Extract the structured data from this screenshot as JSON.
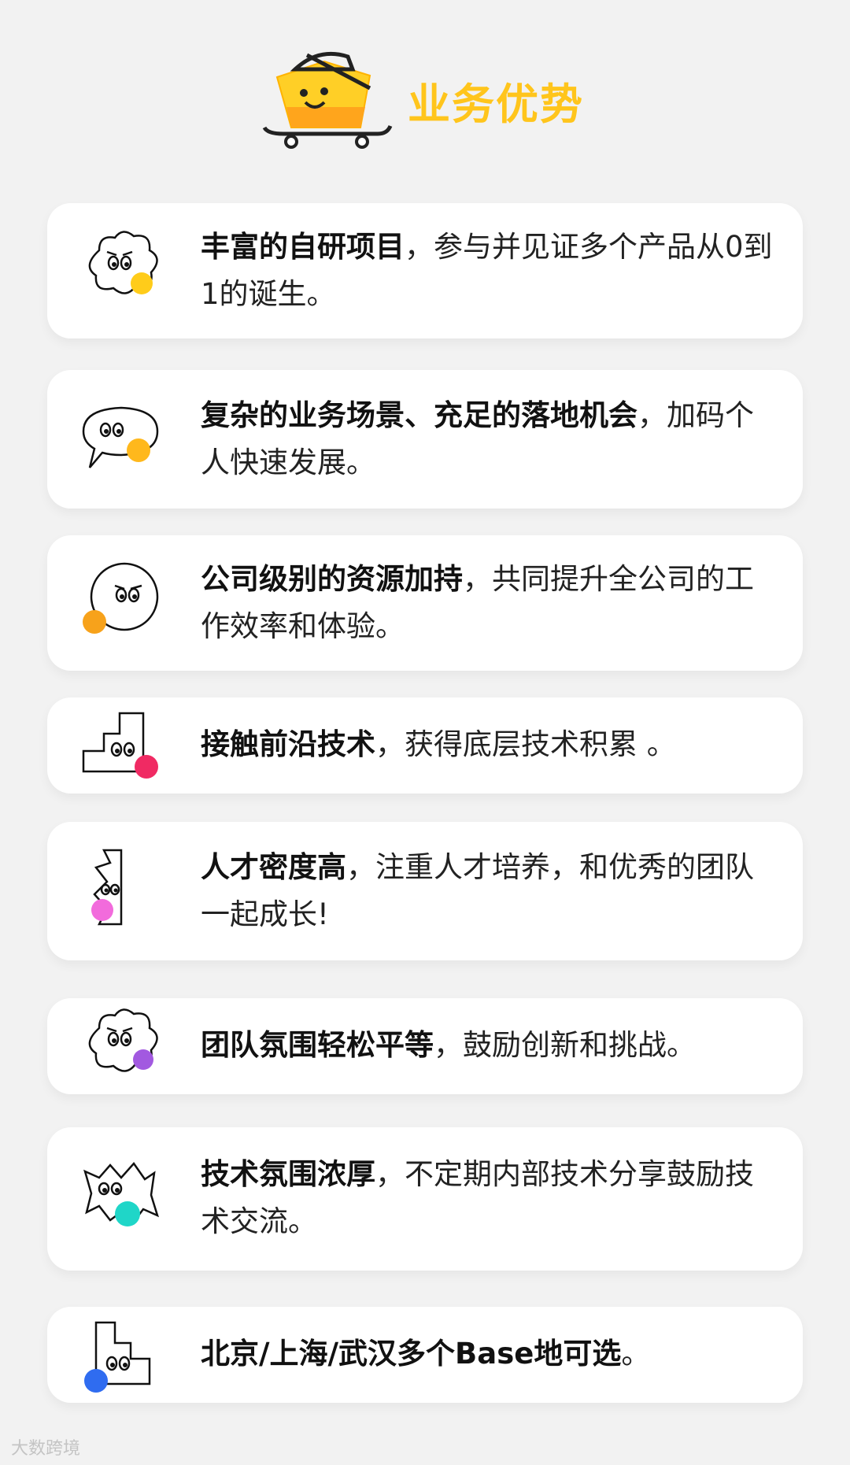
{
  "header": {
    "title": "业务优势"
  },
  "items": [
    {
      "bold": "丰富的自研项目",
      "rest": "，参与并见证多个产品从0到1的诞生。",
      "icon": "cloud-face-icon",
      "dot_color": "#ffcc1a"
    },
    {
      "bold": "复杂的业务场景、充足的落地机会",
      "rest": "，加码个人快速发展。",
      "icon": "speech-bubble-face-icon",
      "dot_color": "#ffb81c"
    },
    {
      "bold": "公司级别的资源加持",
      "rest": "，共同提升全公司的工作效率和体验。",
      "icon": "circle-face-icon",
      "dot_color": "#f7a21b"
    },
    {
      "bold": "接触前沿技术",
      "rest": "，获得底层技术积累 。",
      "icon": "stairs-face-icon",
      "dot_color": "#f02a63"
    },
    {
      "bold": "人才密度高",
      "rest": "，注重人才培养，和优秀的团队一起成长!",
      "icon": "zigzag-face-icon",
      "dot_color": "#f26bdc"
    },
    {
      "bold": "团队氛围轻松平等",
      "rest": "，鼓励创新和挑战。",
      "icon": "cloud-face-icon",
      "dot_color": "#a259e0"
    },
    {
      "bold": "技术氛围浓厚",
      "rest": "，不定期内部技术分享鼓励技术交流。",
      "icon": "spiky-face-icon",
      "dot_color": "#1fd6c8"
    },
    {
      "bold": "北京/上海/武汉多个Base地可选",
      "rest": "。",
      "icon": "blocks-face-icon",
      "dot_color": "#2f6cf0"
    }
  ],
  "watermark": "大数跨境"
}
